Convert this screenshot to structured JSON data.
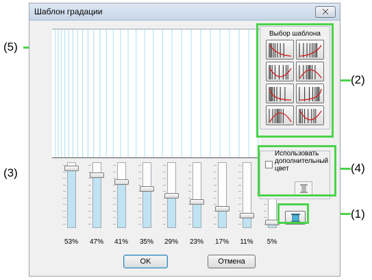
{
  "dialog": {
    "title": "Шаблон градации",
    "close_icon": "close-icon"
  },
  "pattern_group": {
    "legend": "Выбор шаблона",
    "patterns": [
      {
        "icon": "pattern-dense-left-falling-curve-icon"
      },
      {
        "icon": "pattern-dense-right-rising-curve-icon"
      },
      {
        "icon": "pattern-dense-center-valley-curve-icon"
      },
      {
        "icon": "pattern-dense-edges-peak-curve-icon"
      },
      {
        "icon": "pattern-dense-left-arc-down-icon"
      },
      {
        "icon": "pattern-dense-right-arc-up-icon"
      },
      {
        "icon": "pattern-arch-icon"
      },
      {
        "icon": "pattern-inverse-arch-icon"
      }
    ]
  },
  "sliders": [
    {
      "label": "53%",
      "value": 0.53
    },
    {
      "label": "47%",
      "value": 0.47
    },
    {
      "label": "41%",
      "value": 0.41
    },
    {
      "label": "35%",
      "value": 0.35
    },
    {
      "label": "29%",
      "value": 0.29
    },
    {
      "label": "23%",
      "value": 0.23
    },
    {
      "label": "17%",
      "value": 0.17
    },
    {
      "label": "11%",
      "value": 0.11
    },
    {
      "label": "5%",
      "value": 0.05
    }
  ],
  "add_color": {
    "label_line1": "Использовать",
    "label_line2": "дополнительный",
    "label_line3": "цвет",
    "checked": false
  },
  "buttons": {
    "ok": "OK",
    "cancel": "Отмена"
  },
  "callouts": {
    "c1": "(1)",
    "c2": "(2)",
    "c3": "(3)",
    "c4": "(4)",
    "c5": "(5)"
  },
  "colors": {
    "highlight_green": "#49d449",
    "stripe_cyan": "#a8e0ec",
    "slider_fill": "#bfe3f3"
  }
}
